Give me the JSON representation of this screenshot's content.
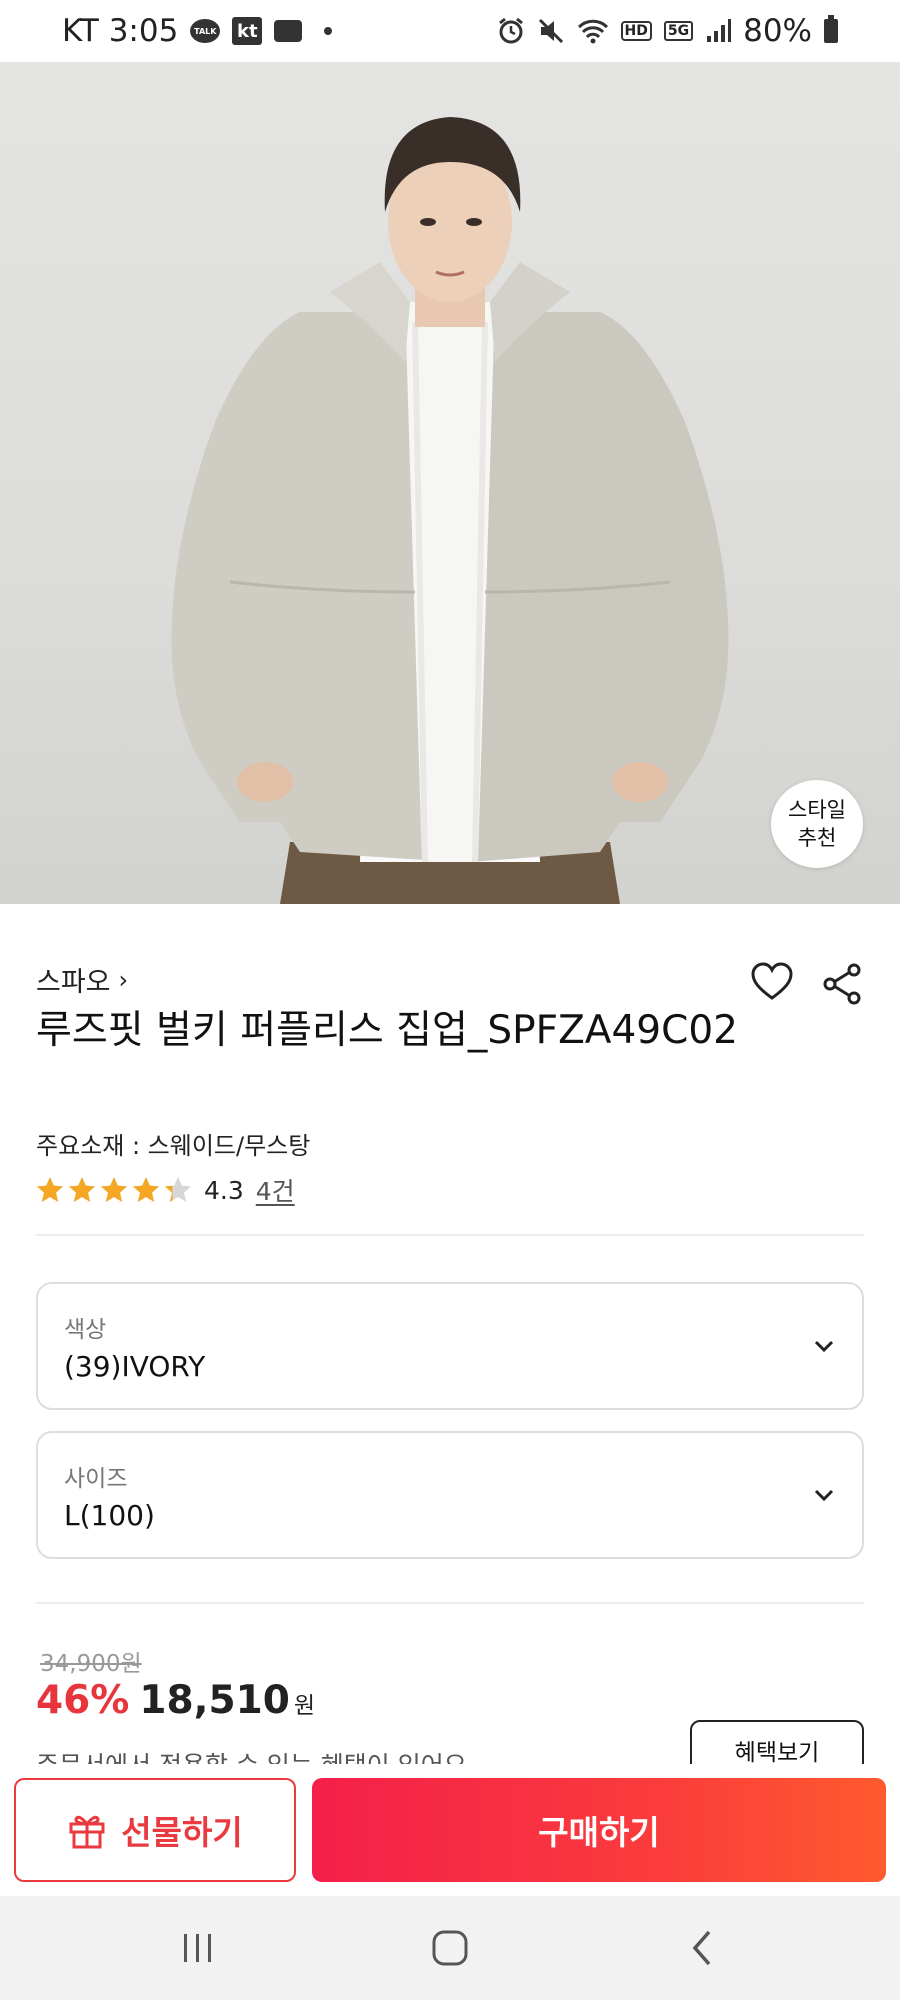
{
  "status_bar": {
    "carrier_time": "KT 3:05",
    "talk_icon_text": "TALK",
    "kt_icon_text": "kt",
    "hd_text": "HD",
    "fiveg_text": "5G",
    "battery": "80%"
  },
  "hero": {
    "style_badge_line1": "스타일",
    "style_badge_line2": "추천"
  },
  "product": {
    "brand": "스파오",
    "brand_chevron": "›",
    "title": "루즈핏 벌키 퍼플리스 집업_SPFZA49C02",
    "material": "주요소재 : 스웨이드/무스탕",
    "rating": 4.3,
    "rating_text": "4.3",
    "review_count": "4건"
  },
  "options": {
    "color": {
      "label": "색상",
      "value": "(39)IVORY"
    },
    "size": {
      "label": "사이즈",
      "value": "L(100)"
    }
  },
  "price": {
    "original": "34,900원",
    "discount": "46%",
    "sale": "18,510",
    "currency": "원",
    "benefit_note": "주문서에서 적용할 수 있는 혜택이 있어요",
    "benefit_button": "혜택보기"
  },
  "actions": {
    "gift": "선물하기",
    "buy": "구매하기"
  },
  "colors": {
    "accent_red": "#e83a3f",
    "star_gold": "#f5a623",
    "discount_red": "#e8343c"
  }
}
